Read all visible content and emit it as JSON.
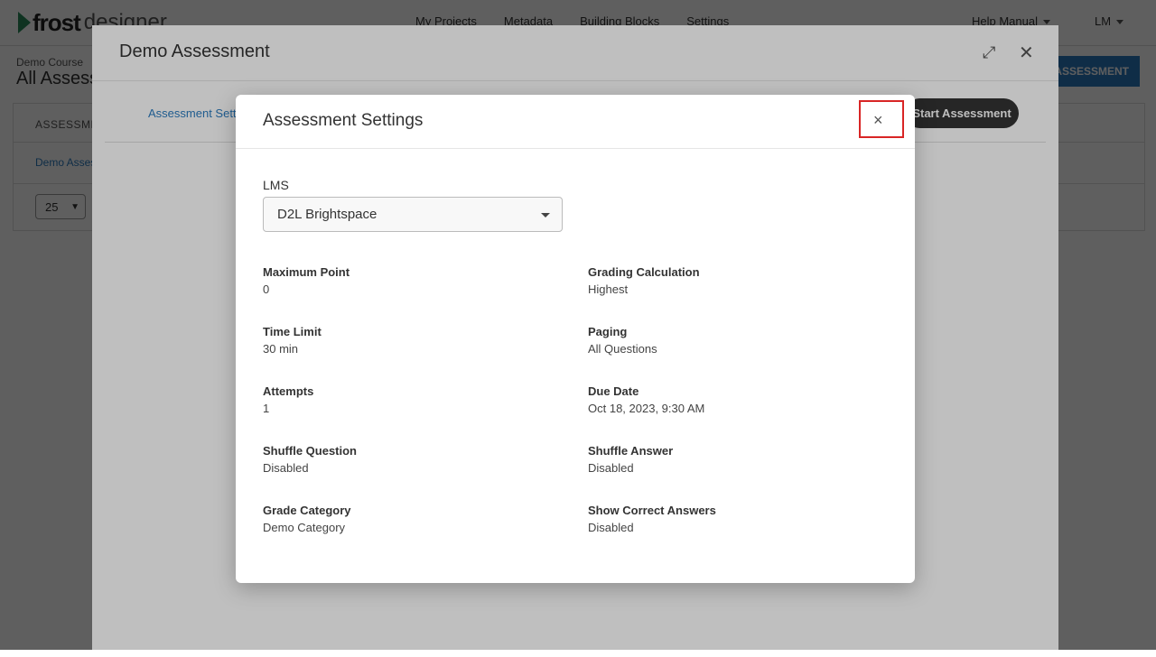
{
  "app": {
    "logo_main": "frost",
    "logo_sub": "designer",
    "nav": [
      "My Projects",
      "Metadata",
      "Building Blocks",
      "Settings"
    ],
    "help_label": "Help Manual",
    "user_initials": "LM",
    "breadcrumb": "Demo Course",
    "page_title": "All Assessments",
    "add_button": "ASSESSMENT",
    "table_header": "ASSESSMENT",
    "table_row_link": "Demo Assessment",
    "page_size": "25"
  },
  "outer_modal": {
    "title": "Demo Assessment",
    "tab_label": "Assessment Settings",
    "start_button": "Start Assessment",
    "expand_icon": "expand-icon",
    "close_icon": "close-icon"
  },
  "inner_modal": {
    "title": "Assessment Settings",
    "close_glyph": "×",
    "lms_label": "LMS",
    "lms_value": "D2L Brightspace",
    "fields": [
      {
        "label": "Maximum Point",
        "value": "0"
      },
      {
        "label": "Grading Calculation",
        "value": "Highest"
      },
      {
        "label": "Time Limit",
        "value": "30 min"
      },
      {
        "label": "Paging",
        "value": "All Questions"
      },
      {
        "label": "Attempts",
        "value": "1"
      },
      {
        "label": "Due Date",
        "value": "Oct 18, 2023, 9:30 AM"
      },
      {
        "label": "Shuffle Question",
        "value": "Disabled"
      },
      {
        "label": "Shuffle Answer",
        "value": "Disabled"
      },
      {
        "label": "Grade Category",
        "value": "Demo Category"
      },
      {
        "label": "Show Correct Answers",
        "value": "Disabled"
      }
    ]
  },
  "colors": {
    "accent": "#2b7bbf",
    "highlight_box": "#d92525",
    "button_dark": "#333333"
  }
}
